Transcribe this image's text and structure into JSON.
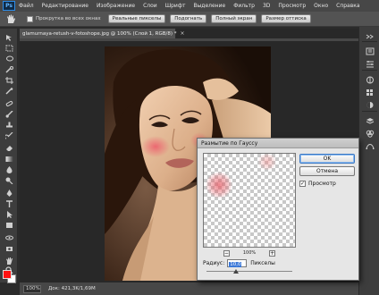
{
  "app": {
    "logo": "Ps"
  },
  "menubar": {
    "items": [
      "Файл",
      "Редактирование",
      "Изображение",
      "Слои",
      "Шрифт",
      "Выделение",
      "Фильтр",
      "3D",
      "Просмотр",
      "Окно",
      "Справка"
    ]
  },
  "options_bar": {
    "scroll_all_windows_label": "Прокрутка во всех окнах",
    "buttons": [
      "Реальные пикселы",
      "Подогнать",
      "Полный экран",
      "Размер оттиска"
    ]
  },
  "document": {
    "tab_title": "glamurnaya-retush-v-fotoshope.jpg @ 100% (Слой 1, RGB/8) *",
    "tab_close": "×"
  },
  "statusbar": {
    "zoom": "100%",
    "doc_info": "Док: 421,3K/1,69M"
  },
  "colors": {
    "foreground": "#ff1111",
    "background": "#ffffff",
    "accent": "#3b78d8"
  },
  "dialog": {
    "title": "Размытие по Гауссу",
    "ok_label": "OK",
    "cancel_label": "Отмена",
    "preview_label": "Просмотр",
    "preview_checked": true,
    "preview_check_mark": "✓",
    "zoom_out_label": "−",
    "zoom_in_label": "+",
    "zoom_value": "100%",
    "radius_label": "Радиус:",
    "radius_value": "10,0",
    "radius_unit": "Пикселы",
    "radius_fraction": 0.34
  }
}
